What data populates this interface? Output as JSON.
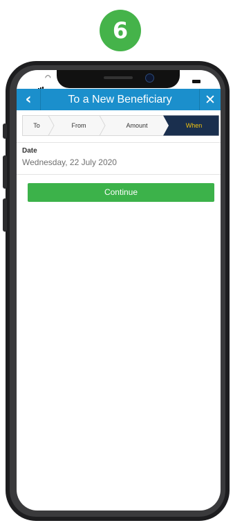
{
  "step_badge": "6",
  "header": {
    "title": "To a New Beneficiary",
    "back_icon": "chevron-left-icon",
    "close_icon": "close-icon"
  },
  "stepper": {
    "steps": [
      {
        "label": "To",
        "active": false
      },
      {
        "label": "From",
        "active": false
      },
      {
        "label": "Amount",
        "active": false
      },
      {
        "label": "When",
        "active": true
      }
    ],
    "active_color": "#f2c40f",
    "active_bg": "#1a2f4e"
  },
  "form": {
    "date_label": "Date",
    "date_value": "Wednesday, 22 July 2020",
    "continue_label": "Continue"
  },
  "colors": {
    "header": "#1b8fcc",
    "continue": "#3cb24a",
    "badge": "#45b34a"
  }
}
